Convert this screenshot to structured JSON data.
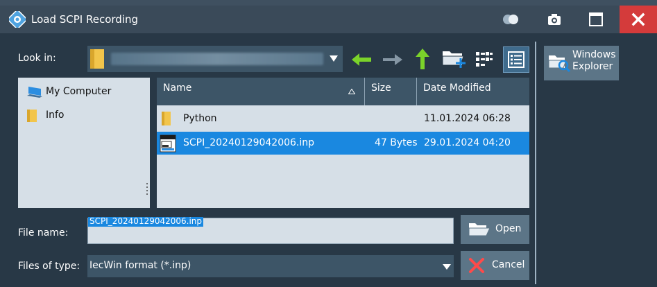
{
  "window": {
    "title": "Load SCPI Recording"
  },
  "look_in": {
    "label": "Look in:"
  },
  "sidebar": {
    "items": [
      {
        "label": "My Computer",
        "icon": "computer-icon"
      },
      {
        "label": "Info",
        "icon": "folder-icon"
      }
    ]
  },
  "file_list": {
    "columns": [
      "Name",
      "Size",
      "Date Modified"
    ],
    "sort_column": "Name",
    "rows": [
      {
        "name": "Python",
        "size": "",
        "date": "11.01.2024 06:28",
        "icon": "folder-icon",
        "selected": false
      },
      {
        "name": "SCPI_20240129042006.inp",
        "size": "47 Bytes",
        "date": "29.01.2024 04:20",
        "icon": "inp-file-icon",
        "selected": true
      }
    ]
  },
  "file_name": {
    "label": "File name:",
    "value": "SCPI_20240129042006.inp"
  },
  "files_of_type": {
    "label": "Files of type:",
    "value": "IecWin format (*.inp)"
  },
  "buttons": {
    "open": "Open",
    "cancel": "Cancel",
    "explorer_line1": "Windows",
    "explorer_line2": "Explorer"
  },
  "colors": {
    "background": "#283846",
    "selection": "#1a88e0",
    "close_button": "#d43b3b",
    "nav_arrow_green": "#7bd32a"
  }
}
